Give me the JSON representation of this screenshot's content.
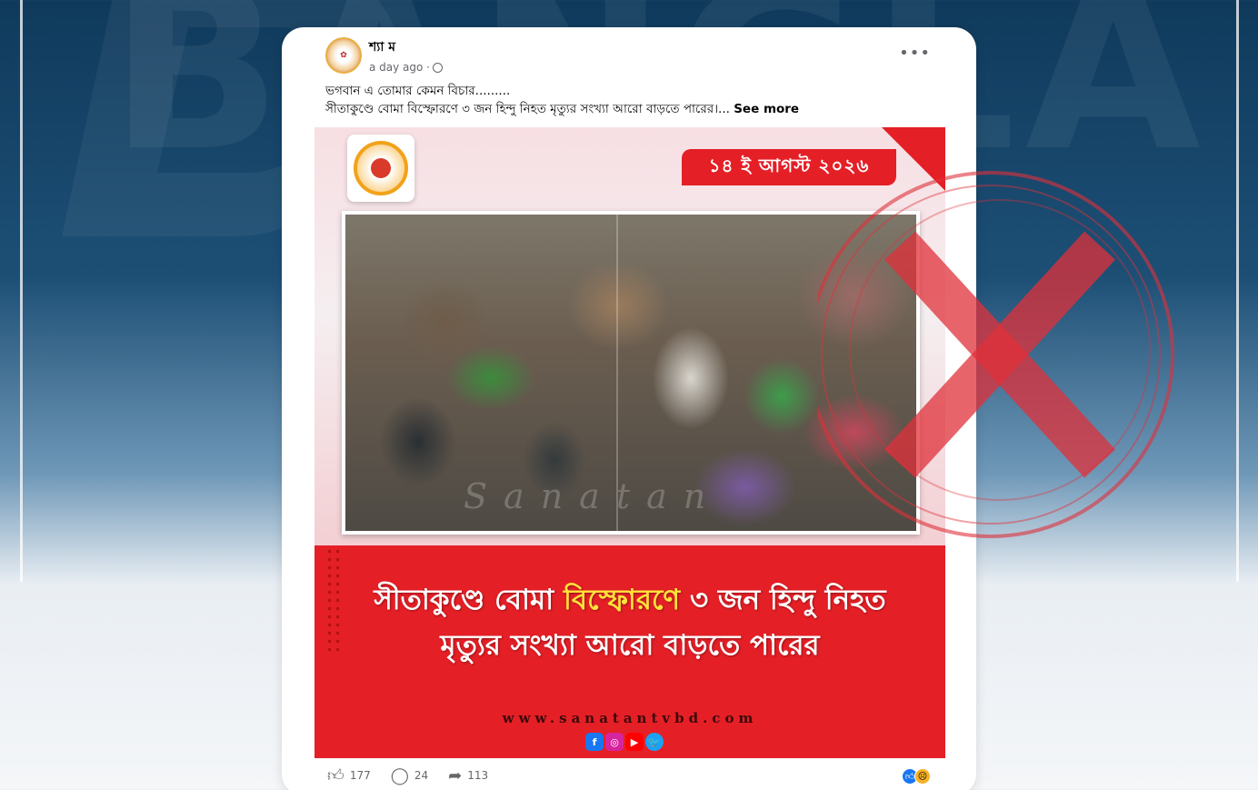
{
  "background": {
    "watermark_text": "BANGLA",
    "colors": {
      "top": "#0f3a5c",
      "bottom": "#f4f6f8"
    }
  },
  "post": {
    "author": "শ্যা ম",
    "timestamp": "a day ago ·",
    "privacy_icon": "globe-icon",
    "more_icon": "more-options-icon",
    "caption_line1": "ভগবান এ তোমার কেমন বিচার.........",
    "caption_line2": "সীতাকুণ্ডে বোমা  বিস্ফোরণে ৩ জন হিন্দু নিহত মৃত্যুর সংখ্যা আরো বাড়তে পারের।...",
    "see_more": "See more",
    "image": {
      "date_badge": "১৪ ই আগস্ট ২০২৬",
      "photo_watermark": "Sanatan",
      "headline_part1": "সীতাকুণ্ডে বোমা ",
      "headline_highlight": "বিস্ফোরণে",
      "headline_part2": " ৩ জন হিন্দু নিহত",
      "headline_line2": "মৃত্যুর সংখ্যা আরো বাড়তে পারের",
      "site_url": "www.sanatantvbd.com",
      "social_icons": [
        "facebook-icon",
        "instagram-icon",
        "youtube-icon",
        "twitter-icon"
      ],
      "colors": {
        "brand_red": "#e51f26",
        "highlight_yellow": "#ffe23a"
      }
    },
    "footer": {
      "likes": "177",
      "comments": "24",
      "shares": "113",
      "reaction_icons": [
        "like-reaction-icon",
        "sad-reaction-icon"
      ]
    }
  },
  "overlay": {
    "stamp": "red-x-fake-stamp",
    "stamp_color": "#e0303a"
  }
}
